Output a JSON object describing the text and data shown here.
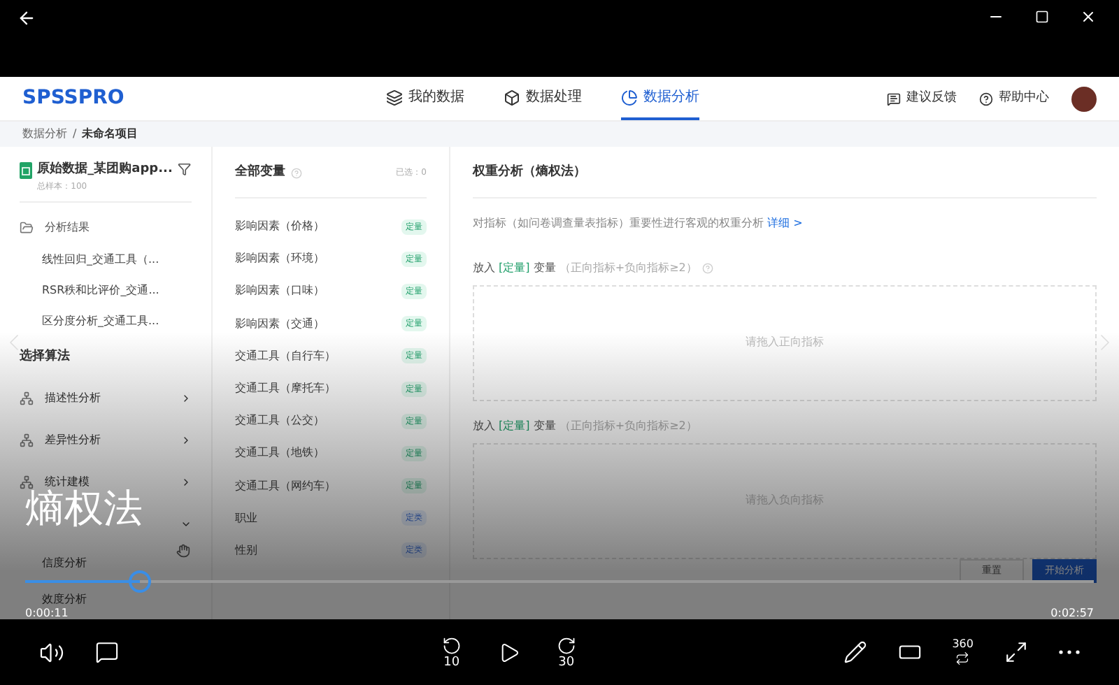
{
  "app": {
    "logo": "SPSSPRO",
    "nav": [
      {
        "label": "我的数据",
        "selected": false,
        "kind": "layers"
      },
      {
        "label": "数据处理",
        "selected": false,
        "kind": "box"
      },
      {
        "label": "数据分析",
        "selected": true,
        "kind": "pie"
      }
    ],
    "links": [
      {
        "label": "建议反馈",
        "kind": "feedback"
      },
      {
        "label": "帮助中心",
        "kind": "help"
      }
    ],
    "breadcrumb": {
      "parent": "数据分析",
      "separator": "/",
      "current": "未命名项目"
    },
    "file": {
      "name": "原始数据_某团购app...",
      "count": "总样本：100"
    },
    "results": {
      "title": "分析结果",
      "items": [
        "线性回归_交通工具（...",
        "RSR秩和比评价_交通...",
        "区分度分析_交通工具..."
      ]
    },
    "algorithms": {
      "title": "选择算法",
      "categories": [
        {
          "label": "描述性分析",
          "expanded": false
        },
        {
          "label": "差异性分析",
          "expanded": false
        },
        {
          "label": "统计建模",
          "expanded": false
        },
        {
          "expanded": true,
          "children": [
            "信度分析",
            "效度分析"
          ]
        }
      ]
    },
    "variables": {
      "title": "全部变量",
      "selected_count": "已选：0",
      "items": [
        {
          "name": "影响因素（价格）",
          "tag": "定量",
          "kind": "quant"
        },
        {
          "name": "影响因素（环境）",
          "tag": "定量",
          "kind": "quant"
        },
        {
          "name": "影响因素（口味）",
          "tag": "定量",
          "kind": "quant"
        },
        {
          "name": "影响因素（交通）",
          "tag": "定量",
          "kind": "quant"
        },
        {
          "name": "交通工具（自行车）",
          "tag": "定量",
          "kind": "quant"
        },
        {
          "name": "交通工具（摩托车）",
          "tag": "定量",
          "kind": "quant"
        },
        {
          "name": "交通工具（公交）",
          "tag": "定量",
          "kind": "quant"
        },
        {
          "name": "交通工具（地铁）",
          "tag": "定量",
          "kind": "quant"
        },
        {
          "name": "交通工具（网约车）",
          "tag": "定量",
          "kind": "quant"
        },
        {
          "name": "职业",
          "tag": "定类",
          "kind": "cat"
        },
        {
          "name": "性别",
          "tag": "定类",
          "kind": "cat"
        }
      ]
    },
    "method": {
      "title": "权重分析（熵权法）",
      "description": "对指标（如问卷调查量表指标）重要性进行客观的权重分析",
      "link": "详细 >",
      "zones": [
        {
          "prefix": "放入",
          "type": "[定量]",
          "suffix": "变量",
          "hint": "（正向指标+负向指标≥2）",
          "help": true,
          "prompt": "请拖入正向指标"
        },
        {
          "prefix": "放入",
          "type": "[定量]",
          "suffix": "变量",
          "hint": "（正向指标+负向指标≥2）",
          "help": false,
          "prompt": "请拖入负向指标"
        }
      ],
      "buttons": [
        {
          "label": "重置",
          "kind": "secondary"
        },
        {
          "label": "开始分析",
          "kind": "primary"
        }
      ]
    }
  },
  "player": {
    "subtitle": "熵权法",
    "seek": {
      "level": 0.107
    },
    "elapsed": "0:00:11",
    "total": "0:02:57",
    "rewind": "10",
    "forward": "30",
    "vr": "360"
  }
}
